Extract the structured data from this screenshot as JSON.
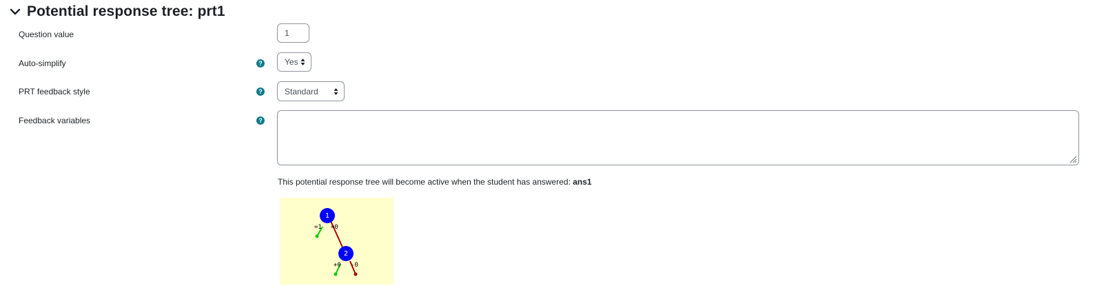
{
  "section": {
    "title": "Potential response tree: prt1",
    "chevron_icon": "chevron-down-icon"
  },
  "fields": {
    "question_value": {
      "label": "Question value",
      "value": "1"
    },
    "auto_simplify": {
      "label": "Auto-simplify",
      "value": "Yes",
      "help_icon": "question-circle-icon"
    },
    "feedback_style": {
      "label": "PRT feedback style",
      "value": "Standard",
      "help_icon": "question-circle-icon"
    },
    "feedback_variables": {
      "label": "Feedback variables",
      "value": "",
      "help_icon": "question-circle-icon"
    }
  },
  "active_note": {
    "text": "This potential response tree will become active when the student has answered:",
    "answer": "ans1"
  },
  "tree": {
    "nodes": [
      {
        "label": "1"
      },
      {
        "label": "2"
      }
    ],
    "branch_labels": {
      "node1_true": "=1",
      "node1_false": "=0",
      "node2_true": "+0",
      "node2_false": "-0"
    },
    "colors": {
      "background": "#ffffcc",
      "node": "#0000ff",
      "true_branch": "#00cc00",
      "false_branch": "#aa0000"
    }
  },
  "colors": {
    "help_icon": "#117a8b",
    "text": "#1d2125",
    "border": "#8f959e"
  }
}
